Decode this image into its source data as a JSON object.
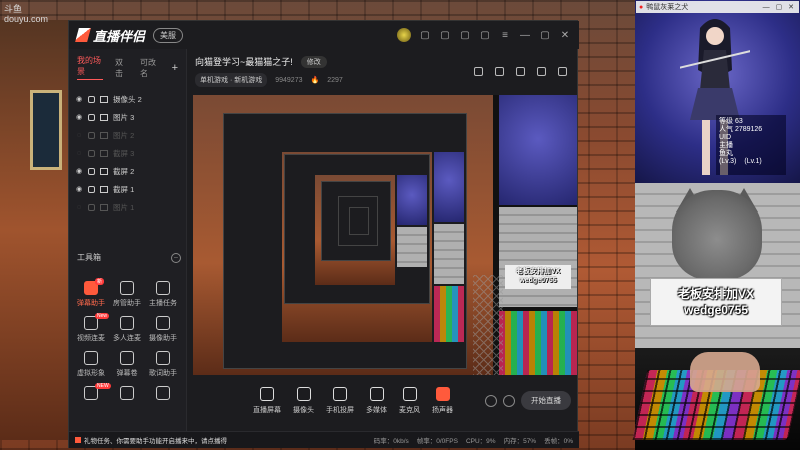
{
  "background": {
    "logo_line1": "斗鱼",
    "logo_line2": "douyu.com"
  },
  "app": {
    "brand": "直播伴侣",
    "edition": "美服",
    "window_controls": [
      "—",
      "▢",
      "✕"
    ],
    "scene_tabs": [
      "我的场景",
      "双击",
      "可改名"
    ],
    "add_symbol": "+",
    "sources": [
      {
        "label": "摄像头 2",
        "visible": true
      },
      {
        "label": "图片 3",
        "visible": true
      },
      {
        "label": "图片 2",
        "visible": false
      },
      {
        "label": "截屏 3",
        "visible": false
      },
      {
        "label": "截屏 2",
        "visible": true
      },
      {
        "label": "截屏 1",
        "visible": true
      },
      {
        "label": "图片 1",
        "visible": false
      }
    ],
    "tools_title": "工具箱",
    "tools": [
      {
        "label": "弹幕助手",
        "hot": true,
        "badge": "新"
      },
      {
        "label": "房管助手",
        "hot": false,
        "badge": ""
      },
      {
        "label": "主播任务",
        "hot": false,
        "badge": ""
      },
      {
        "label": "视频连麦",
        "hot": false,
        "badge": "New"
      },
      {
        "label": "多人连麦",
        "hot": false,
        "badge": ""
      },
      {
        "label": "摄像助手",
        "hot": false,
        "badge": ""
      },
      {
        "label": "虚拟形象",
        "hot": false,
        "badge": ""
      },
      {
        "label": "弹幕卷",
        "hot": false,
        "badge": ""
      },
      {
        "label": "歌词助手",
        "hot": false,
        "badge": ""
      },
      {
        "label": "",
        "hot": false,
        "badge": "NEW"
      },
      {
        "label": "",
        "hot": false,
        "badge": ""
      },
      {
        "label": "",
        "hot": false,
        "badge": ""
      }
    ],
    "stream_title": "向猫登学习~最猫猫之子!",
    "edit_label": "修改",
    "category": "单机游戏 · 新机游戏",
    "room_id": "9949273",
    "followers": "2297",
    "bottom_tools": [
      "直播屏幕",
      "摄像头",
      "手机投屏",
      "多媒体",
      "麦克风",
      "扬声器"
    ],
    "start_label": "开始直播",
    "status_notice": "礼物任务、你需要助手功能开启播来中，请点播得",
    "status_stats": [
      "码率：0kb/s",
      "帧率：0/0FPS",
      "CPU：9%",
      "内存：57%",
      "丢帧：0%"
    ]
  },
  "anime_window": {
    "title": "鸭鼠灰莱之犬",
    "stats": [
      "等级    63",
      "人气  2789126",
      "UID",
      "主播",
      "鱼丸",
      "(Lv.3)",
      "(Lv.1)"
    ]
  },
  "cat_sign": {
    "line1": "老板安排加VX",
    "line2": "wedge0755"
  },
  "nested_sign": {
    "line1": "老板安排加VX",
    "line2": "wedge0755"
  }
}
